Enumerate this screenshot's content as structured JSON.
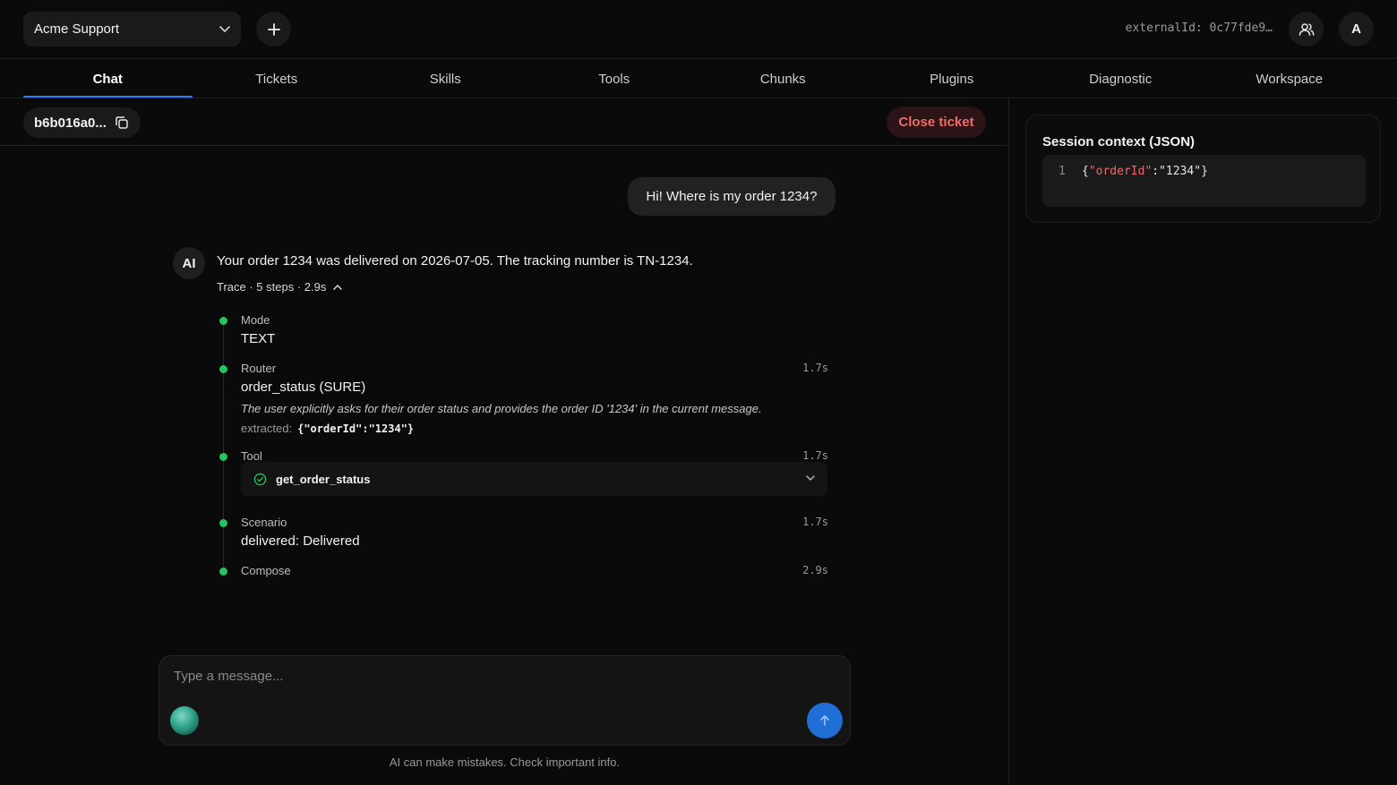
{
  "header": {
    "workspace": "Acme Support",
    "external_id": "externalId: 0c77fde9…",
    "avatar_letter": "A"
  },
  "tabs": [
    {
      "label": "Chat",
      "active": true
    },
    {
      "label": "Tickets"
    },
    {
      "label": "Skills"
    },
    {
      "label": "Tools"
    },
    {
      "label": "Chunks"
    },
    {
      "label": "Plugins"
    },
    {
      "label": "Diagnostic"
    },
    {
      "label": "Workspace"
    }
  ],
  "ticket": {
    "id": "b6b016a0...",
    "close_label": "Close ticket"
  },
  "chat": {
    "user_message": "Hi! Where is my order 1234?",
    "ai_avatar": "AI",
    "ai_message": "Your order 1234 was delivered on 2026-07-05. The tracking number is TN-1234.",
    "trace_summary": "Trace · 5 steps · 2.9s",
    "steps": {
      "mode": {
        "label": "Mode",
        "value": "TEXT"
      },
      "router": {
        "label": "Router",
        "time": "1.7s",
        "value": "order_status (SURE)",
        "reason": "The user explicitly asks for their order status and provides the order ID '1234' in the current message.",
        "extracted_label": "extracted:",
        "extracted_value": "{\"orderId\":\"1234\"}"
      },
      "tool": {
        "label": "Tool",
        "time": "1.7s",
        "tool_name": "get_order_status"
      },
      "scenario": {
        "label": "Scenario",
        "time": "1.7s",
        "value": "delivered: Delivered"
      },
      "compose": {
        "label": "Compose",
        "time": "2.9s"
      }
    }
  },
  "composer": {
    "placeholder": "Type a message...",
    "disclaimer": "AI can make mistakes. Check important info."
  },
  "session_context": {
    "title": "Session context (JSON)",
    "line_number": "1",
    "open_brace": "{",
    "key": "\"orderId\"",
    "separator": ":",
    "value": "\"1234\"",
    "close_brace": "}"
  },
  "colors": {
    "accent": "#2f7cf6",
    "step_dot": "#22c55e",
    "danger": "#f26b6b",
    "json_key": "#ef6a6a"
  },
  "icons": [
    "chevron-down-icon",
    "plus-icon",
    "users-icon",
    "copy-icon",
    "chevron-up-icon",
    "check-circle-icon",
    "arrow-up-icon"
  ]
}
